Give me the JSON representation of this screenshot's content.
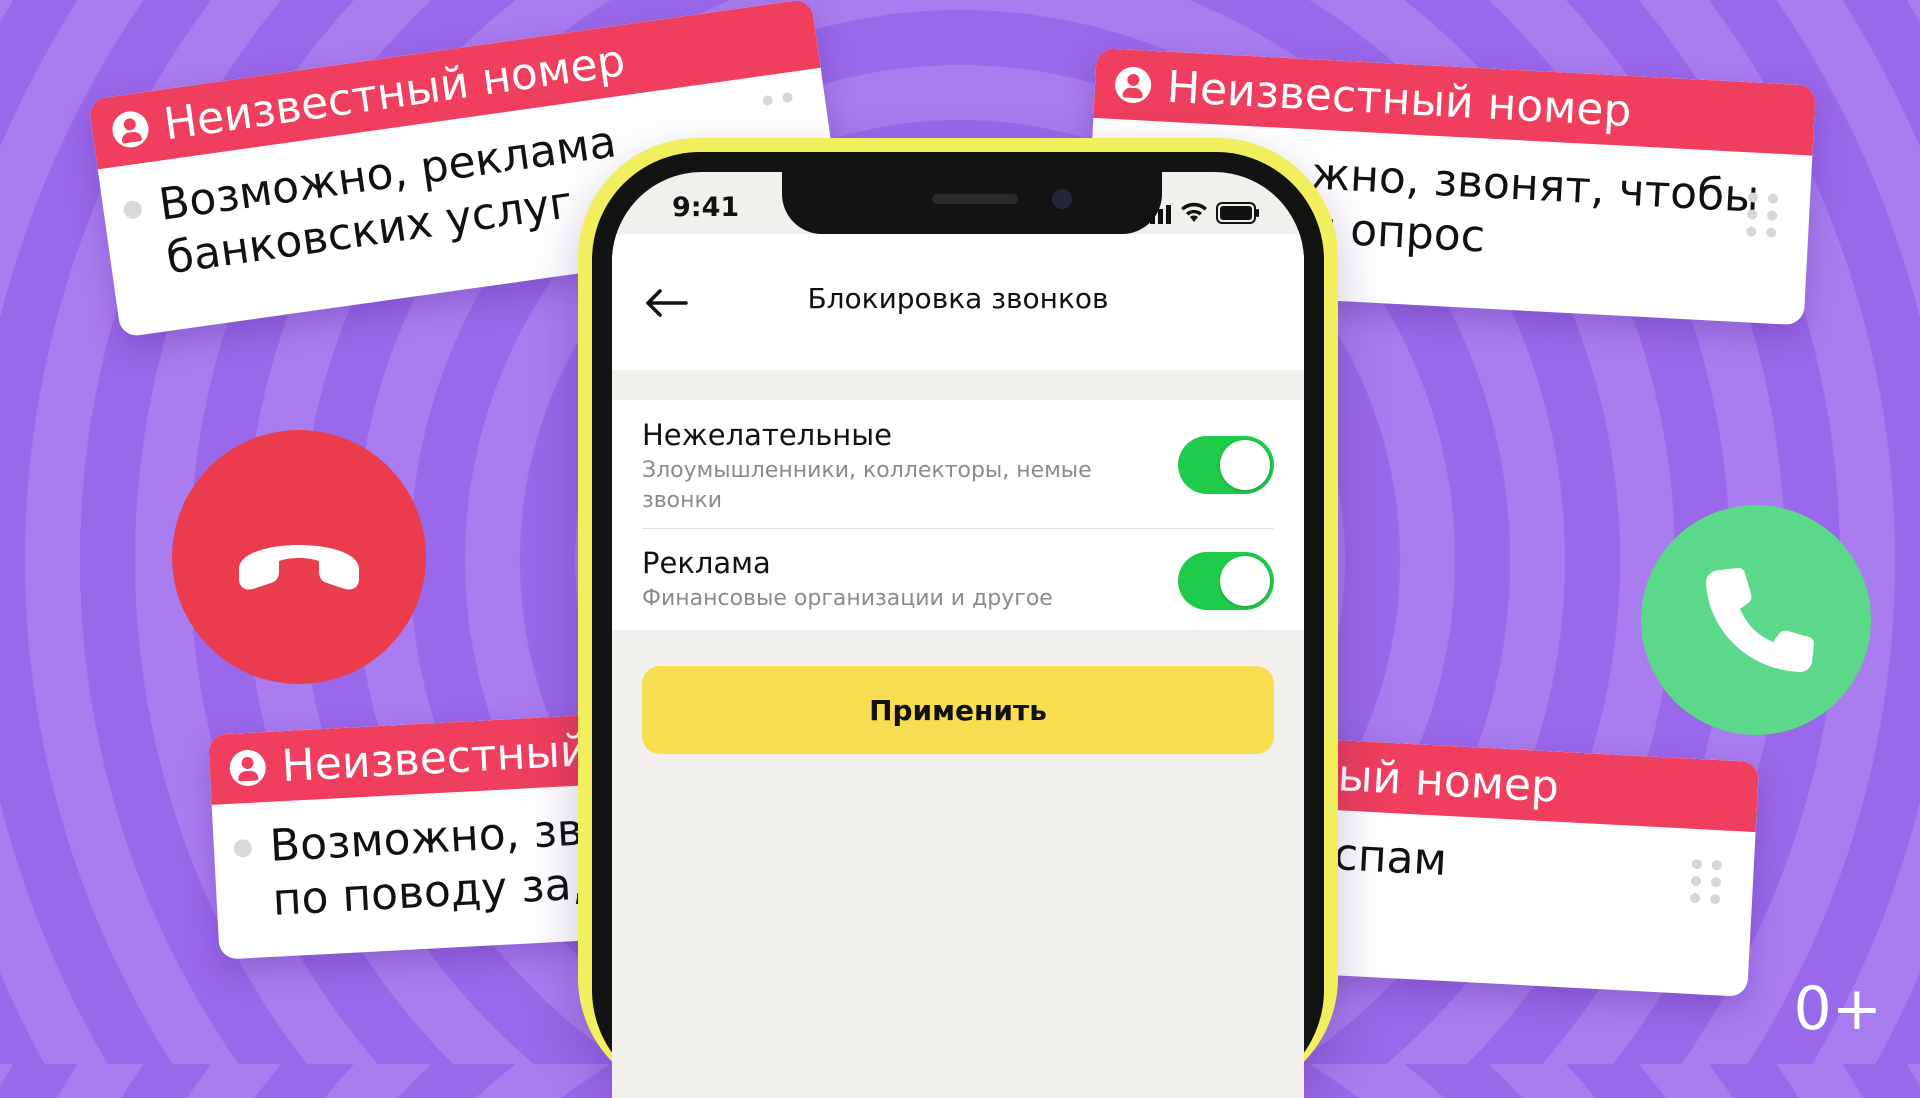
{
  "cards": {
    "top_left": {
      "header": "Неизвестный номер",
      "line1": "Возможно, реклама",
      "line2": "банковских услуг"
    },
    "top_right": {
      "header": "Неизвестный номер",
      "line1": "жно, звонят, чтобы",
      "line2": "и опрос"
    },
    "bottom_left": {
      "header": "Неизвестный",
      "line1": "Возможно, зв",
      "line2": "по поводу за,"
    },
    "bottom_right": {
      "header": "ый номер",
      "line1": "спам"
    }
  },
  "phone": {
    "status_time": "9:41",
    "nav_title": "Блокировка звонков",
    "settings": [
      {
        "title": "Нежелательные",
        "subtitle_line1": "Злоумышленники, коллекторы, немые",
        "subtitle_line2": "звонки",
        "enabled": true
      },
      {
        "title": "Реклама",
        "subtitle_line1": "Финансовые организации и другое",
        "enabled": true
      }
    ],
    "apply_label": "Применить"
  },
  "age_rating": "0+",
  "colors": {
    "accent_red": "#ef3e5e",
    "toggle_green": "#1fcb4a",
    "button_yellow": "#f7dd4f",
    "phone_frame": "#f2ef5e",
    "background": "#a97cf0"
  }
}
